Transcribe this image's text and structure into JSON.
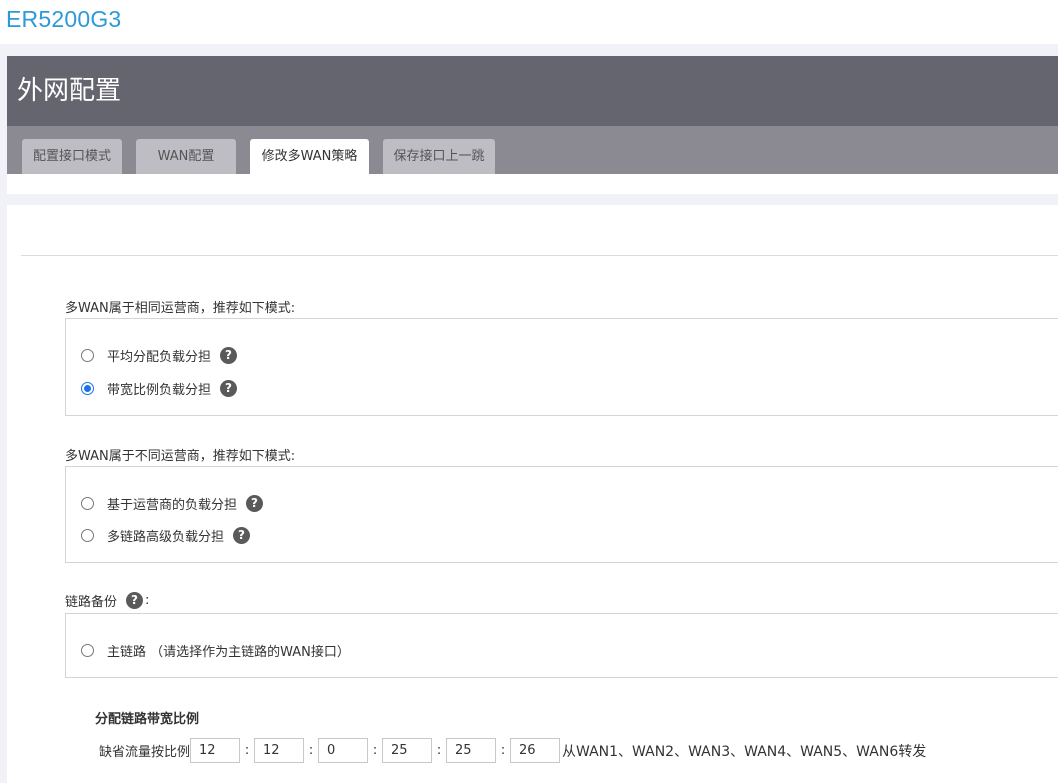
{
  "device": {
    "model": "ER5200G3"
  },
  "page": {
    "title": "外网配置"
  },
  "tabs": [
    {
      "label": "配置接口模式",
      "active": false
    },
    {
      "label": "WAN配置",
      "active": false
    },
    {
      "label": "修改多WAN策略",
      "active": true
    },
    {
      "label": "保存接口上一跳",
      "active": false
    }
  ],
  "same_isp": {
    "label": "多WAN属于相同运营商，推荐如下模式:",
    "options": [
      {
        "label": "平均分配负载分担",
        "checked": false,
        "help": "?"
      },
      {
        "label": "带宽比例负载分担",
        "checked": true,
        "help": "?"
      }
    ]
  },
  "diff_isp": {
    "label": "多WAN属于不同运营商，推荐如下模式:",
    "options": [
      {
        "label": "基于运营商的负载分担",
        "checked": false,
        "help": "?"
      },
      {
        "label": "多链路高级负载分担",
        "checked": false,
        "help": "?"
      }
    ]
  },
  "backup": {
    "label": "链路备份",
    "help": "?",
    "colon": ":",
    "options": [
      {
        "label": "主链路 （请选择作为主链路的WAN接口）",
        "checked": false
      }
    ]
  },
  "bandwidth_ratio": {
    "title": "分配链路带宽比例",
    "prefix": "缺省流量按比例",
    "separator": ":",
    "values": [
      "12",
      "12",
      "0",
      "25",
      "25",
      "26"
    ],
    "suffix": "从WAN1、WAN2、WAN3、WAN4、WAN5、WAN6转发"
  },
  "colors": {
    "brand": "#2d9ad8",
    "title_bar": "#65656f",
    "tab_bar": "#8b8a93",
    "radio_checked": "#1a73e8"
  },
  "icons": {
    "help": "question-circle-icon"
  }
}
